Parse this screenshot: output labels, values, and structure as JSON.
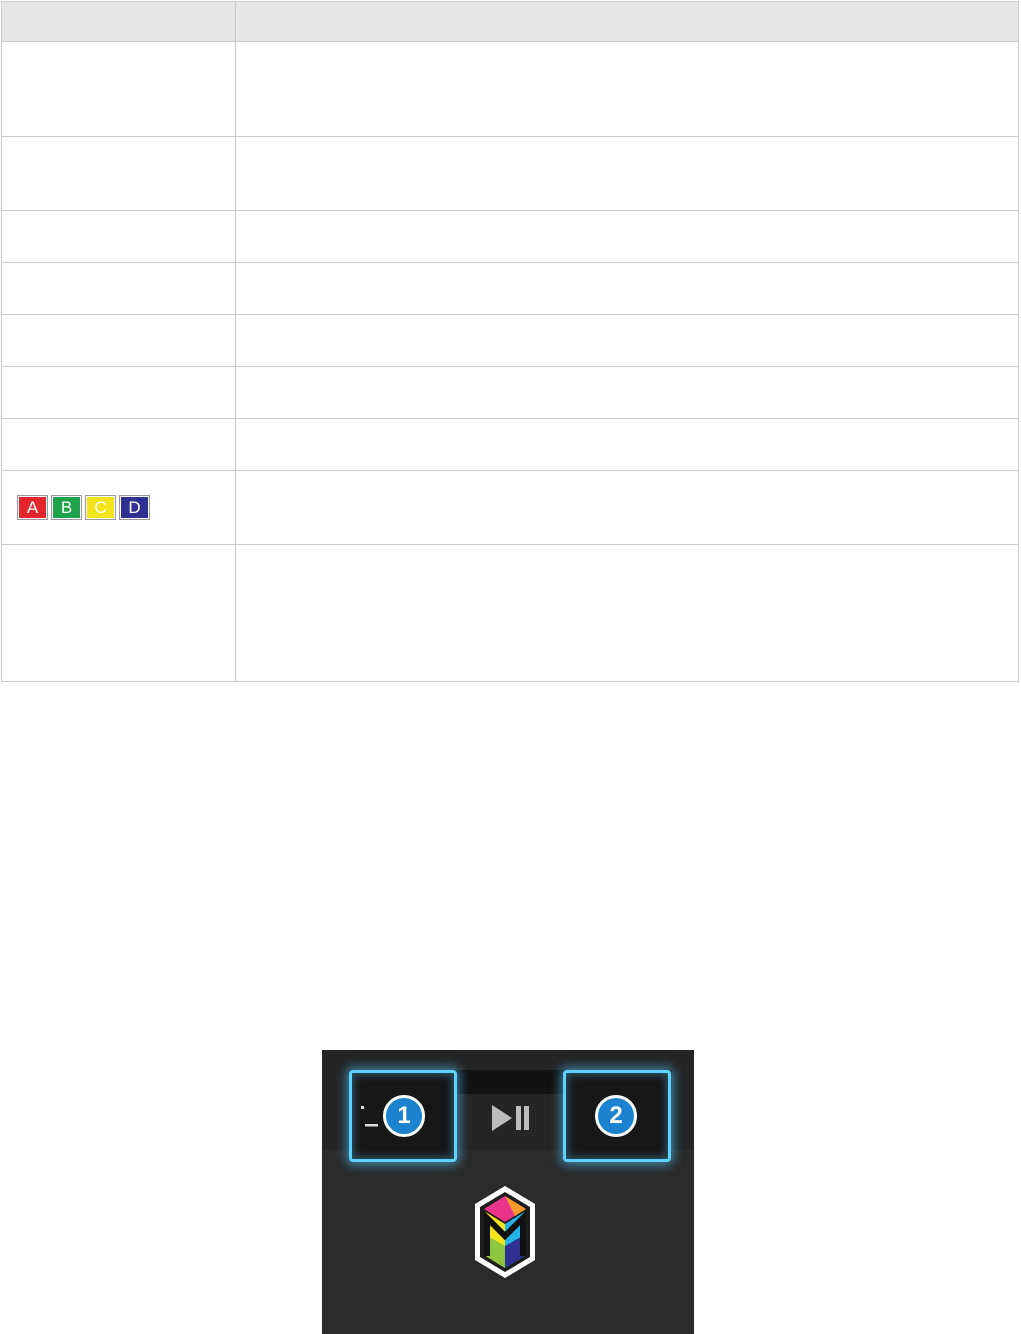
{
  "table": {
    "headers": [
      "",
      ""
    ],
    "rows": [
      {
        "key": "",
        "desc": ""
      },
      {
        "key": "",
        "desc": ""
      },
      {
        "key": "",
        "desc": ""
      },
      {
        "key": "",
        "desc": ""
      },
      {
        "key": "",
        "desc": ""
      },
      {
        "key": "",
        "desc": ""
      },
      {
        "key": "",
        "desc": ""
      },
      {
        "key": "color-buttons",
        "desc": ""
      },
      {
        "key": "",
        "desc": ""
      }
    ],
    "color_buttons": [
      {
        "label": "A",
        "color": "#e3262b"
      },
      {
        "label": "B",
        "color": "#1ea24a"
      },
      {
        "label": "C",
        "color": "#f2e41c"
      },
      {
        "label": "D",
        "color": "#2e3192"
      }
    ]
  },
  "remote": {
    "badge_1": "1",
    "badge_2": "2",
    "highlight_color": "#5fd3ff",
    "badge_color": "#1b82d0",
    "icons": [
      "mark-icon",
      "play-pause-icon",
      "smart-hub-icon"
    ]
  }
}
